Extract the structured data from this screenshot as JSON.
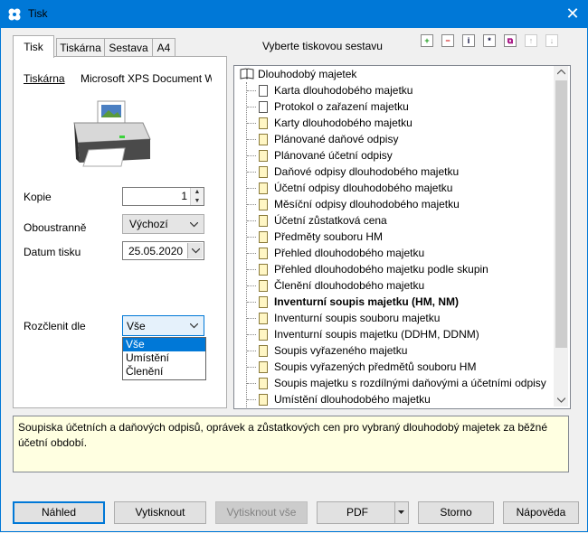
{
  "window": {
    "title": "Tisk",
    "close_glyph": "✕"
  },
  "tabs": [
    {
      "label": "Tisk"
    },
    {
      "label": "Tiskárna"
    },
    {
      "label": "Sestava"
    },
    {
      "label": "A4"
    }
  ],
  "settings": {
    "printer_label": "Tiskárna",
    "printer_value": "Microsoft XPS Document W",
    "copies_label": "Kopie",
    "copies_value": "1",
    "duplex_label": "Oboustranně",
    "duplex_value": "Výchozí",
    "date_label": "Datum tisku",
    "date_value": "25.05.2020",
    "split_label": "Rozčlenit dle",
    "split_value": "Vše",
    "split_options": [
      "Vše",
      "Umístění",
      "Členění"
    ]
  },
  "report_panel": {
    "heading": "Vyberte tiskovou sestavu",
    "toolbar_icons": [
      "add-icon",
      "remove-icon",
      "info-icon",
      "star-doc-icon",
      "copy-doc-icon",
      "move-up-icon",
      "move-down-icon"
    ],
    "tree_root": "Dlouhodobý majetek",
    "items": [
      {
        "label": "Karta dlouhodobého majetku",
        "icon": "white"
      },
      {
        "label": "Protokol o zařazení majetku",
        "icon": "white"
      },
      {
        "label": "Karty dlouhodobého majetku",
        "icon": "yellow"
      },
      {
        "label": "Plánované daňové odpisy",
        "icon": "yellow"
      },
      {
        "label": "Plánované účetní odpisy",
        "icon": "yellow"
      },
      {
        "label": "Daňové odpisy dlouhodobého majetku",
        "icon": "yellow"
      },
      {
        "label": "Účetní odpisy dlouhodobého majetku",
        "icon": "yellow"
      },
      {
        "label": "Měsíční odpisy dlouhodobého majetku",
        "icon": "yellow"
      },
      {
        "label": "Účetní zůstatková cena",
        "icon": "yellow"
      },
      {
        "label": "Předměty souboru HM",
        "icon": "yellow"
      },
      {
        "label": "Přehled dlouhodobého majetku",
        "icon": "yellow"
      },
      {
        "label": "Přehled dlouhodobého majetku podle skupin",
        "icon": "yellow"
      },
      {
        "label": "Členění dlouhodobého majetku",
        "icon": "yellow"
      },
      {
        "label": "Inventurní soupis majetku (HM, NM)",
        "icon": "yellow",
        "selected": true
      },
      {
        "label": "Inventurní soupis souboru majetku",
        "icon": "yellow"
      },
      {
        "label": "Inventurní soupis majetku (DDHM, DDNM)",
        "icon": "yellow"
      },
      {
        "label": "Soupis vyřazeného majetku",
        "icon": "yellow"
      },
      {
        "label": "Soupis vyřazených předmětů souboru HM",
        "icon": "yellow"
      },
      {
        "label": "Soupis majetku s rozdílnými daňovými a účetními odpisy",
        "icon": "yellow"
      },
      {
        "label": "Umístění dlouhodobého majetku",
        "icon": "yellow"
      }
    ]
  },
  "description": "Soupiska účetních a daňových odpisů, oprávek a zůstatkových cen pro vybraný dlouhodobý majetek za běžné účetní období.",
  "buttons": {
    "preview": "Náhled",
    "print": "Vytisknout",
    "print_all": "Vytisknout vše",
    "pdf": "PDF",
    "cancel": "Storno",
    "help": "Nápověda"
  },
  "colors": {
    "accent": "#0078d7",
    "description_bg": "#ffffe1"
  }
}
